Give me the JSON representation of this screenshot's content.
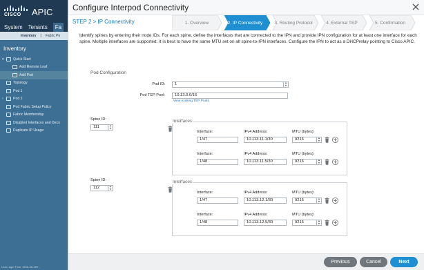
{
  "app": {
    "logo": "cisco",
    "title": "APIC",
    "nav_tabs": [
      "System",
      "Tenants",
      "Fa"
    ],
    "sub_nav": [
      "Inventory",
      "Fabric Po"
    ],
    "sidebar_title": "Inventory",
    "sidebar_items": [
      {
        "label": "Quick Start",
        "icon": "quick-start-icon"
      },
      {
        "label": "Add Remote Leaf",
        "icon": "document-icon"
      },
      {
        "label": "Add Pod",
        "icon": "document-icon"
      },
      {
        "label": "Topology",
        "icon": "topology-icon"
      },
      {
        "label": "Pod 1",
        "icon": "pod-icon"
      },
      {
        "label": "Pod 2",
        "icon": "pod-icon"
      },
      {
        "label": "Pod Fabric Setup Policy",
        "icon": "folder-icon"
      },
      {
        "label": "Fabric Membership",
        "icon": "folder-icon"
      },
      {
        "label": "Disabled Interfaces and Deco",
        "icon": "folder-icon"
      },
      {
        "label": "Duplicate IP Usage",
        "icon": "folder-icon"
      }
    ],
    "footer_text": "Last Login Time: 2018-08-28T..."
  },
  "modal": {
    "title": "Configure Interpod Connectivity",
    "step_label": "STEP 2 > IP Connectivity",
    "steps": [
      "1. Overview",
      "2. IP Connectivity",
      "3. Routing Protocol",
      "4. External TEP",
      "5. Confirmation"
    ],
    "intro": "Identify spines by entering their node IDs. For each spine, define the interfaces that are connected to the IPN and provide IPN configuration for at least one interface for each spine. Multiple interfaces are supported. It is best to have the same MTU set on all spine-to-IPN interfaces. Configure the IPN to act as a DHCPrelay pointing to Cisco APIC.",
    "pod_config": {
      "section_label": "Pod Configuration",
      "pod_id_label": "Pod ID:",
      "pod_id_value": "1",
      "tep_pool_label": "Pod TEP Pool:",
      "tep_pool_value": "10.13.0.0/16",
      "view_tep_link": "View existing TEP Pools"
    },
    "interface_labels": {
      "spine_id": "Spine ID:",
      "interfaces": "Interfaces",
      "interface": "Interface:",
      "ipv4": "IPv4 Address:",
      "mtu": "MTU (bytes):"
    },
    "spines": [
      {
        "spine_id": "111",
        "interfaces": [
          {
            "interface": "1/47",
            "ipv4": "10.113.11.1/30",
            "mtu": "9216"
          },
          {
            "interface": "1/48",
            "ipv4": "10.113.11.5/30",
            "mtu": "9216"
          }
        ]
      },
      {
        "spine_id": "112",
        "interfaces": [
          {
            "interface": "1/47",
            "ipv4": "10.113.12.1/30",
            "mtu": "9216"
          },
          {
            "interface": "1/48",
            "ipv4": "10.113.12.5/30",
            "mtu": "9216"
          }
        ]
      }
    ],
    "buttons": {
      "previous": "Previous",
      "cancel": "Cancel",
      "next": "Next"
    }
  },
  "colors": {
    "accent": "#1f8fd1",
    "sidebar": "#3d6f94",
    "header": "#1f3a52",
    "step_active": "#1f8fd1",
    "step_label": "#0b7bc4"
  }
}
